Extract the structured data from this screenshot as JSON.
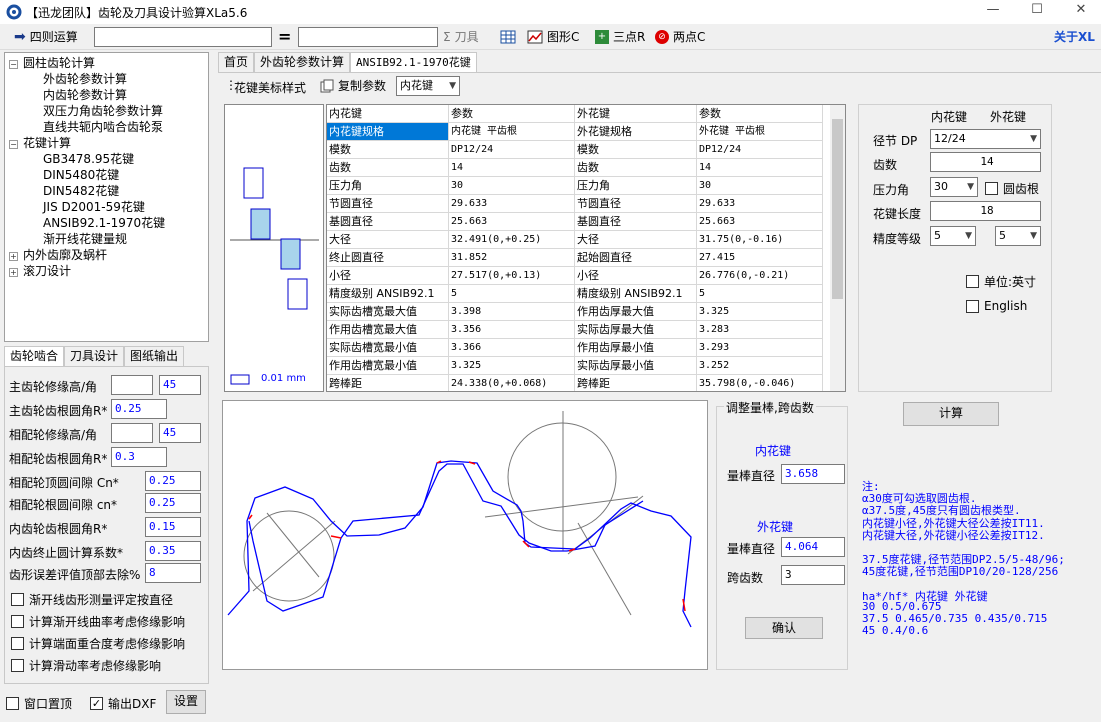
{
  "window": {
    "title": "【迅龙团队】齿轮及刀具设计验算XLa5.6"
  },
  "toolbar": {
    "calc_label": "四则运算",
    "calc_value": "",
    "equals": "=",
    "result_value": "",
    "tool_label": "刀具",
    "chart_label": "图形C",
    "three_label": "三点R",
    "two_label": "两点C",
    "about_label": "关于XL"
  },
  "tree": {
    "items": [
      {
        "label": "圆柱齿轮计算",
        "exp": "−"
      },
      {
        "label": "外齿轮参数计算"
      },
      {
        "label": "内齿轮参数计算"
      },
      {
        "label": "双压力角齿轮参数计算"
      },
      {
        "label": "直线共轭内啮合齿轮泵"
      },
      {
        "label": "花键计算",
        "exp": "−"
      },
      {
        "label": "GB3478.95花键"
      },
      {
        "label": "DIN5480花键"
      },
      {
        "label": "DIN5482花键"
      },
      {
        "label": "JIS D2001-59花键"
      },
      {
        "label": "ANSIB92.1-1970花键"
      },
      {
        "label": "渐开线花键量规"
      },
      {
        "label": "内外齿廓及蜗杆",
        "exp": "+"
      },
      {
        "label": "滚刀设计",
        "exp": "+"
      }
    ]
  },
  "left_tabs": [
    "齿轮啮合",
    "刀具设计",
    "图纸输出"
  ],
  "left_form": {
    "rows": [
      {
        "label": "主齿轮修缘高/角",
        "a": "",
        "b": "45"
      },
      {
        "label": "主齿轮齿根圆角R*",
        "a": "0.25"
      },
      {
        "label": "相配轮修缘高/角",
        "a": "",
        "b": "45"
      },
      {
        "label": "相配轮齿根圆角R*",
        "a": "0.3"
      },
      {
        "label": "相配轮顶圆间隙   Cn*",
        "a": "0.25"
      },
      {
        "label": "相配轮根圆间隙   cn*",
        "a": "0.25"
      },
      {
        "label": "内齿轮齿根圆角R*",
        "a": "0.15"
      },
      {
        "label": "内齿终止圆计算系数*",
        "a": "0.35"
      },
      {
        "label": "齿形误差评值顶部去除%",
        "a": "8"
      }
    ],
    "checks": [
      "渐开线齿形测量评定按直径",
      "计算渐开线曲率考虑修缘影响",
      "计算端面重合度考虑修缘影响",
      "计算滑动率考虑修缘影响"
    ]
  },
  "bottom": {
    "pin_label": "窗口置顶",
    "dxf_label": "输出DXF",
    "settings_label": "设置"
  },
  "main_tabs": [
    "首页",
    "外齿轮参数计算",
    "ANSIB92.1-1970花键"
  ],
  "subbar": {
    "style_label": "花键美标样式",
    "copy_label": "复制参数",
    "select_value": "内花键"
  },
  "preview": {
    "scale_label": "0.01 mm"
  },
  "grid": {
    "headers": [
      "内花键",
      "参数",
      "外花键",
      "参数"
    ],
    "rows": [
      [
        "内花键规格",
        "内花键 平齿根",
        "外花键规格",
        "外花键 平齿根"
      ],
      [
        "模数",
        "DP12/24",
        "模数",
        "DP12/24"
      ],
      [
        "齿数",
        "14",
        "齿数",
        "14"
      ],
      [
        "压力角",
        "30",
        "压力角",
        "30"
      ],
      [
        "节圆直径",
        "29.633",
        "节圆直径",
        "29.633"
      ],
      [
        "基圆直径",
        "25.663",
        "基圆直径",
        "25.663"
      ],
      [
        "大径",
        "32.491(0,+0.25)",
        "大径",
        "31.75(0,-0.16)"
      ],
      [
        "终止圆直径",
        "31.852",
        "起始圆直径",
        "27.415"
      ],
      [
        "小径",
        "27.517(0,+0.13)",
        "小径",
        "26.776(0,-0.21)"
      ],
      [
        "精度级别 ANSIB92.1",
        "5",
        "精度级别 ANSIB92.1",
        "5"
      ],
      [
        "实际齿槽宽最大值",
        "3.398",
        "作用齿厚最大值",
        "3.325"
      ],
      [
        "作用齿槽宽最大值",
        "3.356",
        "实际齿厚最大值",
        "3.283"
      ],
      [
        "实际齿槽宽最小值",
        "3.366",
        "作用齿厚最小值",
        "3.293"
      ],
      [
        "作用齿槽宽最小值",
        "3.325",
        "实际齿厚最小值",
        "3.252"
      ],
      [
        "跨棒距",
        "24.338(0,+0.068)",
        "跨棒距",
        "35.798(0,-0.046)"
      ]
    ]
  },
  "right": {
    "col1": "内花键",
    "col2": "外花键",
    "dp_label": "径节 DP",
    "dp_value": "12/24",
    "teeth_label": "齿数",
    "teeth_value": "14",
    "pa_label": "压力角",
    "pa_value": "30",
    "round_label": "圆齿根",
    "len_label": "花键长度",
    "len_value": "18",
    "grade_label": "精度等级",
    "grade_in": "5",
    "grade_out": "5",
    "unit_label": "单位:英寸",
    "eng_label": "English",
    "calc_button": "计算"
  },
  "pins": {
    "title": "调整量棒,跨齿数",
    "inner": "内花键",
    "inner_label": "量棒直径",
    "inner_value": "3.658",
    "outer": "外花键",
    "outer_label": "量棒直径",
    "outer_value": "4.064",
    "span_label": "跨齿数",
    "span_value": "3",
    "ok": "确认"
  },
  "notes": [
    "注:",
    "α30度可勾选取圆齿根.",
    "α37.5度,45度只有圆齿根类型.",
    "内花键小径,外花键大径公差按IT11.",
    "内花键大径,外花键小径公差按IT12.",
    "",
    "37.5度花键,径节范围DP2.5/5-48/96;",
    "45度花键,径节范围DP10/20-128/256",
    "",
    "ha*/hf*  内花键      外花键",
    "30              0.5/0.675",
    "37.5  0.465/0.735  0.435/0.715",
    "45              0.4/0.6"
  ],
  "colors": {
    "accent": "#0000ff",
    "selection": "#0078d7",
    "profile": "#0000ff",
    "tip": "#ff0000"
  }
}
